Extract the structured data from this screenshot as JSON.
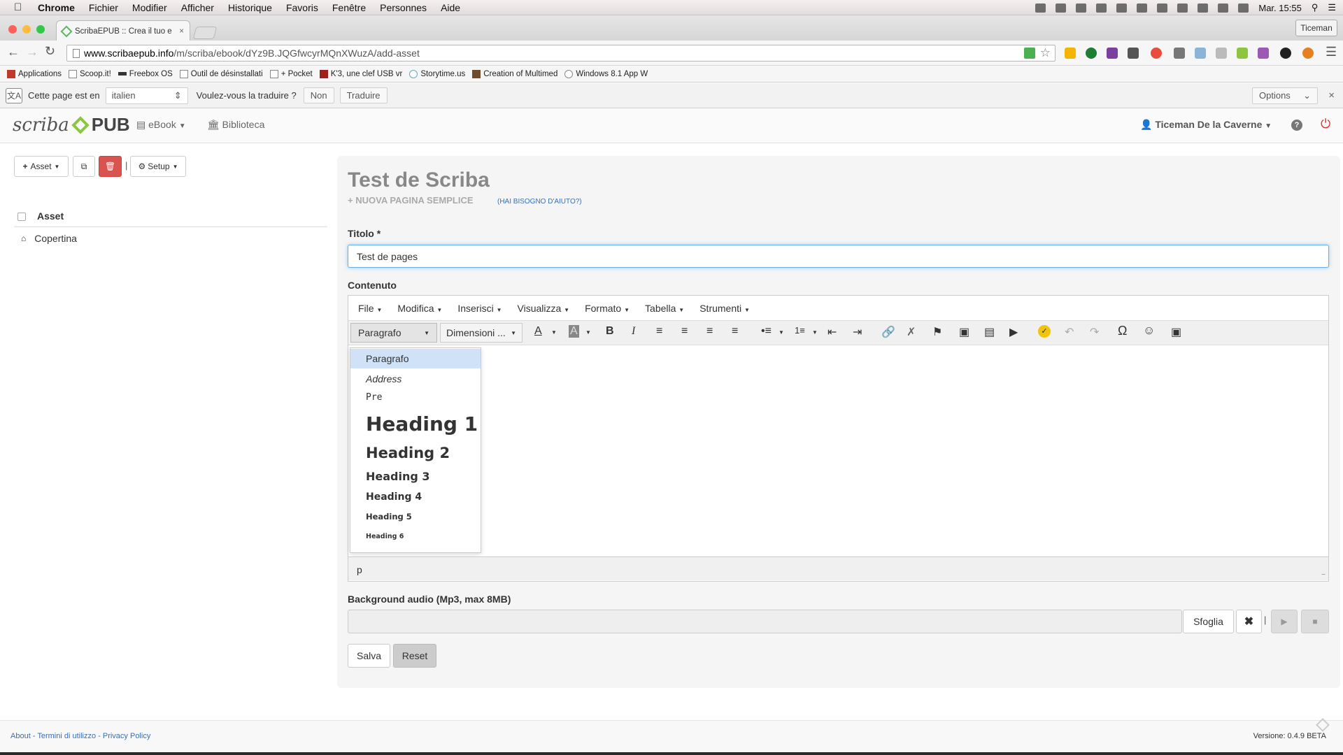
{
  "mac_menubar": {
    "app": "Chrome",
    "items": [
      "Fichier",
      "Modifier",
      "Afficher",
      "Historique",
      "Favoris",
      "Fenêtre",
      "Personnes",
      "Aide"
    ],
    "clock": "Mar. 15:55"
  },
  "browser": {
    "tab_title": "ScribaEPUB :: Crea il tuo e",
    "user_button": "Ticeman",
    "url_host": "www.scribaepub.info",
    "url_path": "/m/scriba/ebook/dYz9B.JQGfwcyrMQnXWuzA/add-asset",
    "bookmarks": [
      "Applications",
      "Scoop.it!",
      "Freebox OS",
      "Outil de désinstallati",
      "+ Pocket",
      "K'3, une clef USB vr",
      "Storytime.us",
      "Creation of Multimed",
      "Windows 8.1 App W"
    ]
  },
  "translate_bar": {
    "prefix": "Cette page est en",
    "language": "italien",
    "question": "Voulez-vous la traduire ?",
    "no_label": "Non",
    "translate_label": "Traduire",
    "options_label": "Options"
  },
  "app_nav": {
    "logo_script": "scriba",
    "logo_pub": "PUB",
    "ebook_label": "eBook",
    "library_label": "Biblioteca",
    "user_name": "Ticeman De la Caverne"
  },
  "left_panel": {
    "asset_button": "Asset",
    "setup_button": "Setup",
    "list_header": "Asset",
    "items": [
      {
        "label": "Copertina",
        "icon": "home-icon"
      }
    ]
  },
  "form": {
    "title": "Test de Scriba",
    "subtitle": "NUOVA PAGINA SEMPLICE",
    "help_link": "(HAI BISOGNO D'AIUTO?)",
    "titolo_label": "Titolo *",
    "titolo_value": "Test de pages",
    "contenuto_label": "Contenuto",
    "audio_label": "Background audio (Mp3, max 8MB)",
    "browse_label": "Sfoglia",
    "save_label": "Salva",
    "reset_label": "Reset"
  },
  "editor": {
    "menus": [
      "File",
      "Modifica",
      "Inserisci",
      "Visualizza",
      "Formato",
      "Tabella",
      "Strumenti"
    ],
    "format_select": "Paragrafo",
    "size_select": "Dimensioni ...",
    "format_options": [
      "Paragrafo",
      "Address",
      "Pre",
      "Heading 1",
      "Heading 2",
      "Heading 3",
      "Heading 4",
      "Heading 5",
      "Heading 6"
    ],
    "status_path": "p"
  },
  "footer": {
    "about": "About",
    "terms": "Termini di utilizzo",
    "privacy": "Privacy Policy",
    "version": "Versione: 0.4.9 BETA"
  },
  "colors": {
    "accent_green": "#8cc63f",
    "danger_red": "#d9534f",
    "highlight_blue": "#cfe2f7",
    "link_blue": "#3a6fb5",
    "power_red": "#d9302a"
  }
}
